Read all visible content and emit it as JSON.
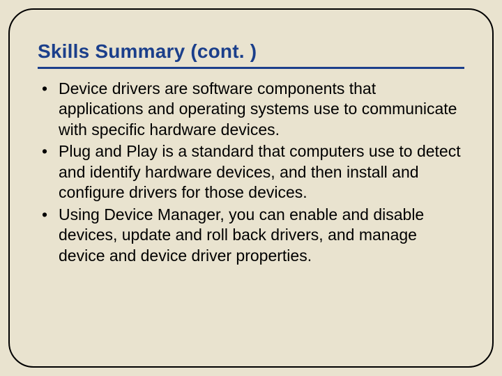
{
  "title": "Skills Summary (cont. )",
  "bullets": [
    "Device drivers are software components that applications and operating systems use to communicate with specific hardware devices.",
    "Plug and Play is a standard that computers use to detect and identify hardware devices, and then install and configure drivers for those devices.",
    "Using Device Manager, you can enable and disable devices, update and roll back drivers, and manage device and device driver properties."
  ]
}
